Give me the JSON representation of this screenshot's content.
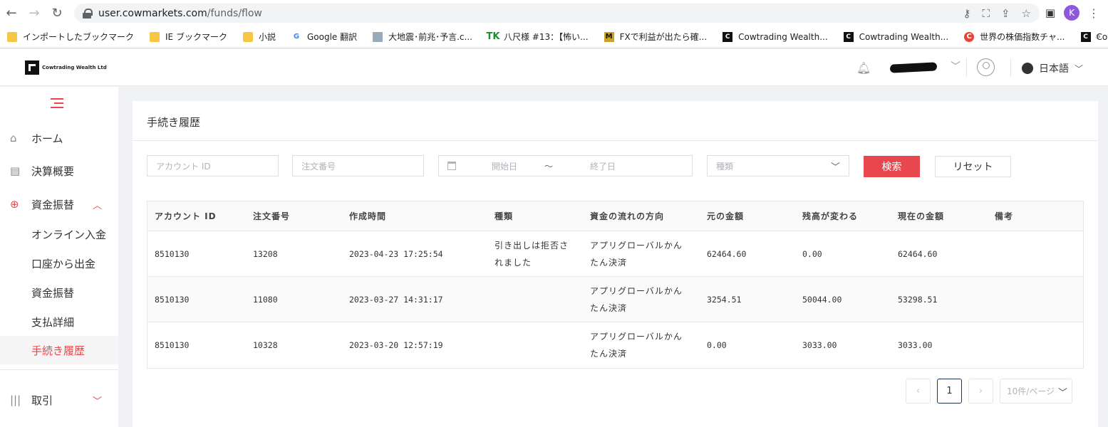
{
  "browser": {
    "url_host": "user.cowmarkets.com",
    "url_path": "/funds/flow",
    "profile_initial": "K",
    "bookmarks": [
      {
        "label": "インポートしたブックマーク",
        "icon": "folder-icon"
      },
      {
        "label": "IE ブックマーク",
        "icon": "folder-icon"
      },
      {
        "label": "小説",
        "icon": "folder-icon"
      },
      {
        "label": "Google 翻訳",
        "icon": "google-translate-icon"
      },
      {
        "label": "大地震･前兆･予言.c...",
        "icon": "site-image-icon"
      },
      {
        "label": "八尺様 #13：【怖い...",
        "icon": "tk-icon"
      },
      {
        "label": "FXで利益が出たら確...",
        "icon": "m-icon"
      },
      {
        "label": "Cowtrading Wealth...",
        "icon": "cowtrading-icon"
      },
      {
        "label": "Cowtrading Wealth...",
        "icon": "cowtrading-icon"
      },
      {
        "label": "世界の株価指数チャ...",
        "icon": "c-icon"
      },
      {
        "label": "Cowtrading Wealth...",
        "icon": "cowtrading-icon"
      }
    ],
    "more": "»"
  },
  "header": {
    "logo_text": "Cowtrading Wealth Ltd",
    "language": "日本語"
  },
  "sidebar": {
    "items": [
      {
        "label": "ホーム",
        "icon": "home-icon"
      },
      {
        "label": "決算概要",
        "icon": "document-icon"
      },
      {
        "label": "資金振替",
        "icon": "lifebuoy-icon"
      },
      {
        "label": "オンライン入金"
      },
      {
        "label": "口座から出金"
      },
      {
        "label": "資金振替"
      },
      {
        "label": "支払詳細"
      },
      {
        "label": "手続き履歴"
      },
      {
        "label": "取引",
        "icon": "barcode-icon"
      }
    ]
  },
  "page": {
    "title": "手続き履歴",
    "filters": {
      "account_placeholder": "アカウント ID",
      "order_placeholder": "注文番号",
      "start_placeholder": "開始日",
      "date_sep": "～",
      "end_placeholder": "終了日",
      "type_placeholder": "種類"
    },
    "search_label": "検索",
    "reset_label": "リセット"
  },
  "table": {
    "headers": [
      "アカウント ID",
      "注文番号",
      "作成時間",
      "種類",
      "資金の流れの方向",
      "元の金額",
      "残高が変わる",
      "現在の金額",
      "備考"
    ],
    "rows": [
      [
        "8510130",
        "13208",
        "2023-04-23 17:25:54",
        "引き出しは拒否されました",
        "アプリグローバルかんたん決済",
        "62464.60",
        "0.00",
        "62464.60",
        ""
      ],
      [
        "8510130",
        "11080",
        "2023-03-27 14:31:17",
        "",
        "アプリグローバルかんたん決済",
        "3254.51",
        "50044.00",
        "53298.51",
        ""
      ],
      [
        "8510130",
        "10328",
        "2023-03-20 12:57:19",
        "",
        "アプリグローバルかんたん決済",
        "0.00",
        "3033.00",
        "3033.00",
        ""
      ]
    ]
  },
  "pagination": {
    "prev": "‹",
    "current_page": "1",
    "next": "›",
    "page_size": "10件/ページ"
  }
}
